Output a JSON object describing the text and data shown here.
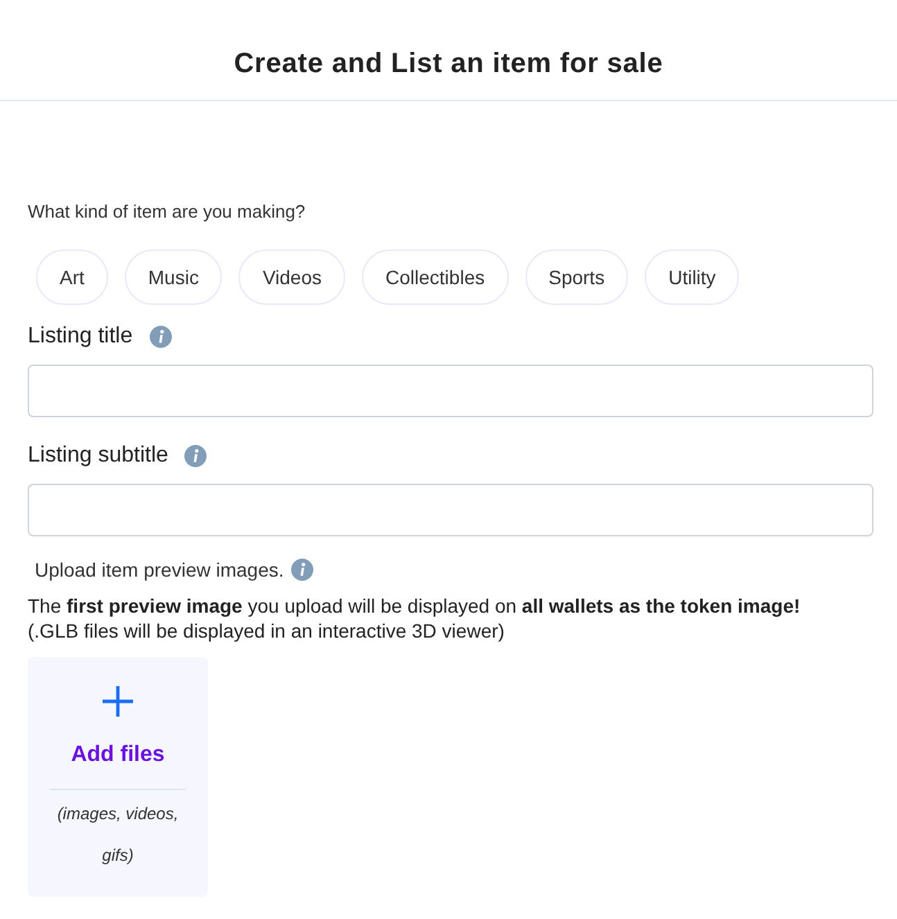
{
  "header": {
    "title": "Create and List an item for sale"
  },
  "category": {
    "question": "What kind of item are you making?",
    "options": [
      {
        "label": "Art",
        "selected": false
      },
      {
        "label": "Music",
        "selected": false
      },
      {
        "label": "Videos",
        "selected": false
      },
      {
        "label": "Collectibles",
        "selected": false
      },
      {
        "label": "Sports",
        "selected": false
      },
      {
        "label": "Utility",
        "selected": false
      }
    ]
  },
  "fields": [
    {
      "label": "Listing title"
    },
    {
      "label": "Listing subtitle"
    }
  ],
  "upload": {
    "label": "Upload item preview images.",
    "note": "The **first preview image** you upload will be displayed on **all wallets as the token image!**",
    "note_2": "(.GLB files will be displayed in an interactive 3D viewer)",
    "dropzone": {
      "action": "Add files",
      "hint": "(images, videos, gifs)"
    }
  }
}
